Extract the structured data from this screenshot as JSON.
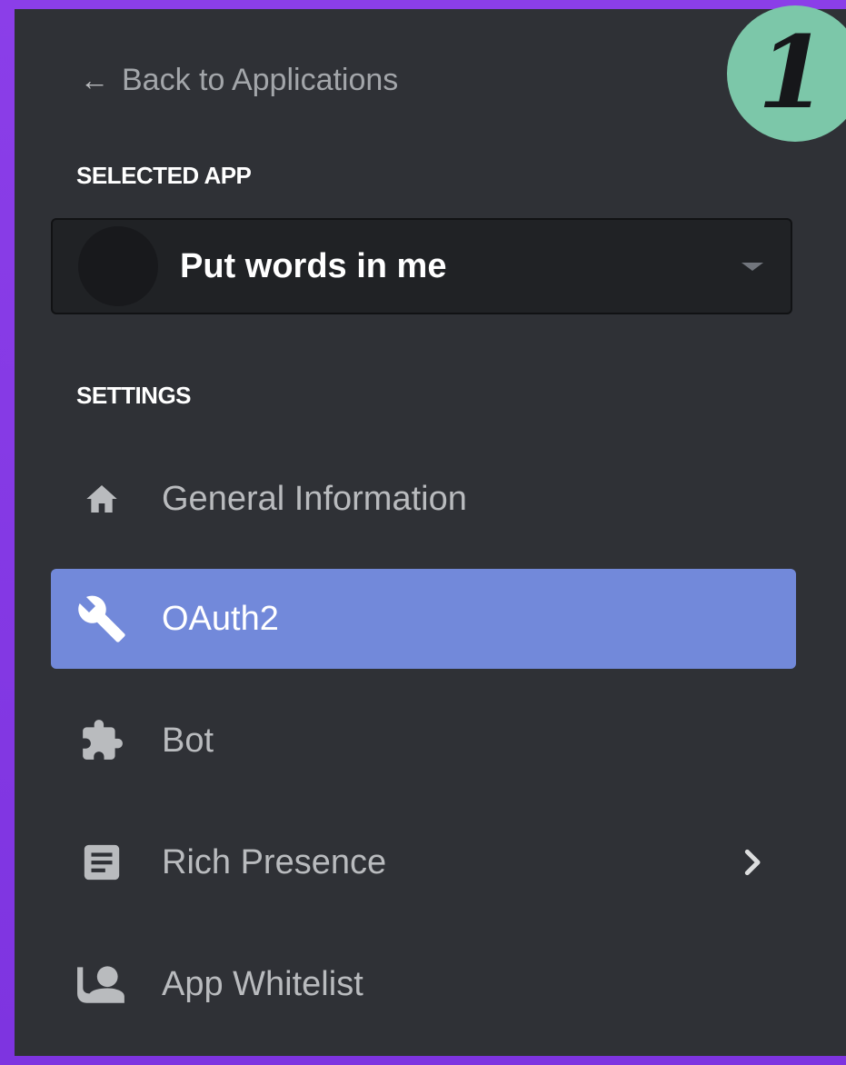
{
  "nav": {
    "back_label": "Back to Applications",
    "back_icon": "arrow-left-icon"
  },
  "selected_app": {
    "section_label": "SELECTED APP",
    "app_name": "Put words in me"
  },
  "settings": {
    "section_label": "SETTINGS",
    "items": [
      {
        "label": "General Information",
        "icon": "home-icon",
        "selected": false
      },
      {
        "label": "OAuth2",
        "icon": "wrench-icon",
        "selected": true
      },
      {
        "label": "Bot",
        "icon": "puzzle-icon",
        "selected": false
      },
      {
        "label": "Rich Presence",
        "icon": "document-icon",
        "selected": false,
        "has_submenu": true
      },
      {
        "label": "App Whitelist",
        "icon": "user-whitelist-icon",
        "selected": false
      }
    ]
  },
  "badge": {
    "number": "1"
  },
  "colors": {
    "background_gradient": "#8b3ee8",
    "panel": "#2f3136",
    "selected_item": "#7289da",
    "badge": "#7cc7a9",
    "muted_text": "#b9bbbe"
  }
}
